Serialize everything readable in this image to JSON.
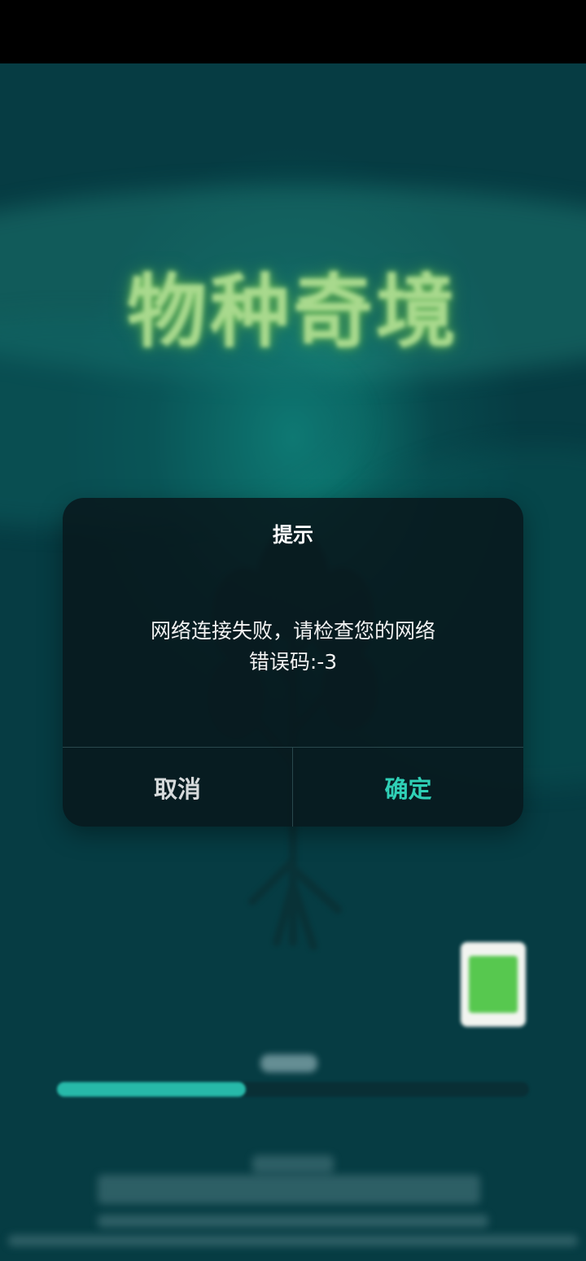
{
  "game": {
    "logo_text": "物种奇境"
  },
  "loading": {
    "progress_percent": 40
  },
  "dialog": {
    "title": "提示",
    "message_line1": "网络连接失败，请检查您的网络",
    "message_line2": "错误码:-3",
    "cancel_label": "取消",
    "confirm_label": "确定"
  },
  "colors": {
    "accent": "#2fd0b6",
    "progress_fill": "#27b9a9",
    "dialog_bg": "#08181c"
  }
}
